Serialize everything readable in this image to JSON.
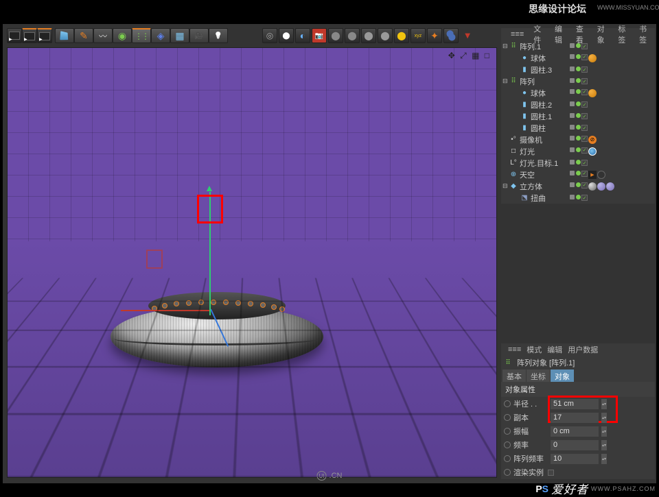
{
  "watermarks": {
    "forum": "思缘设计论坛",
    "forum_url": "WWW.MISSYUAN.COM",
    "ps_p": "P",
    "ps_s": "S",
    "ps_cn": "爱好者",
    "ps_url": "WWW.PSAHZ.COM"
  },
  "viewport": {
    "corner_icons": "✥ ⤢ ▦ □"
  },
  "obj_header": [
    "≡≡≡",
    "文件",
    "编辑",
    "查看",
    "对象",
    "标签",
    "书签"
  ],
  "objects": [
    {
      "indent": 1,
      "exp": "⊟",
      "iconClass": "oi-array",
      "icon": "⠿",
      "name": "阵列.1",
      "tags": [
        "dot",
        "chk"
      ]
    },
    {
      "indent": 2,
      "exp": "",
      "iconClass": "oi-sphere",
      "icon": "●",
      "name": "球体",
      "tags": [
        "dot",
        "chk",
        "mat"
      ]
    },
    {
      "indent": 2,
      "exp": "",
      "iconClass": "oi-cyl",
      "icon": "▮",
      "name": "圆柱.3",
      "tags": [
        "dot",
        "chk"
      ]
    },
    {
      "indent": 1,
      "exp": "⊟",
      "iconClass": "oi-array",
      "icon": "⠿",
      "name": "阵列",
      "tags": [
        "dot",
        "chk"
      ]
    },
    {
      "indent": 2,
      "exp": "",
      "iconClass": "oi-sphere",
      "icon": "●",
      "name": "球体",
      "tags": [
        "dot",
        "chk",
        "mat"
      ]
    },
    {
      "indent": 2,
      "exp": "",
      "iconClass": "oi-cyl",
      "icon": "▮",
      "name": "圆柱.2",
      "tags": [
        "dot",
        "chk"
      ]
    },
    {
      "indent": 2,
      "exp": "",
      "iconClass": "oi-cyl",
      "icon": "▮",
      "name": "圆柱.1",
      "tags": [
        "dot",
        "chk"
      ]
    },
    {
      "indent": 2,
      "exp": "",
      "iconClass": "oi-cyl",
      "icon": "▮",
      "name": "圆柱",
      "tags": [
        "dot",
        "chk"
      ]
    },
    {
      "indent": 1,
      "exp": "",
      "iconClass": "oi-cam",
      "icon": "•°",
      "name": "摄像机",
      "tags": [
        "dot",
        "chk",
        "no"
      ]
    },
    {
      "indent": 1,
      "exp": "",
      "iconClass": "oi-light",
      "icon": "□",
      "name": "灯光",
      "tags": [
        "dot",
        "chk",
        "blue"
      ]
    },
    {
      "indent": 1,
      "exp": "",
      "iconClass": "oi-target",
      "icon": "L°",
      "name": "灯光.目标.1",
      "tags": [
        "dot",
        "chk"
      ]
    },
    {
      "indent": 1,
      "exp": "",
      "iconClass": "oi-sky",
      "icon": "⊕",
      "name": "天空",
      "tags": [
        "dot",
        "chk",
        "anim",
        "mat4"
      ]
    },
    {
      "indent": 1,
      "exp": "⊟",
      "iconClass": "oi-cube",
      "icon": "◆",
      "name": "立方体",
      "tags": [
        "dot",
        "chk",
        "mat2",
        "mat3",
        "mat3"
      ]
    },
    {
      "indent": 2,
      "exp": "",
      "iconClass": "oi-bend",
      "icon": "⬔",
      "name": "扭曲",
      "tags": [
        "dot",
        "chk"
      ]
    }
  ],
  "attr_header": [
    "≡≡≡",
    "模式",
    "编辑",
    "用户数据"
  ],
  "attr_title": "阵列对象 [阵列.1]",
  "attr_tabs": [
    {
      "label": "基本",
      "active": false
    },
    {
      "label": "坐标",
      "active": false
    },
    {
      "label": "对象",
      "active": true
    }
  ],
  "attr_section_title": "对象属性",
  "attr_fields": [
    {
      "label": "半径 . .",
      "value": "51 cm"
    },
    {
      "label": "副本",
      "value": "17"
    },
    {
      "label": "振幅",
      "value": "0 cm"
    },
    {
      "label": "频率",
      "value": "0"
    },
    {
      "label": "阵列频率",
      "value": "10"
    }
  ],
  "attr_checkbox": "渲染实例",
  "bottom_logo": {
    "u": "UI",
    "cn": ".CN"
  }
}
